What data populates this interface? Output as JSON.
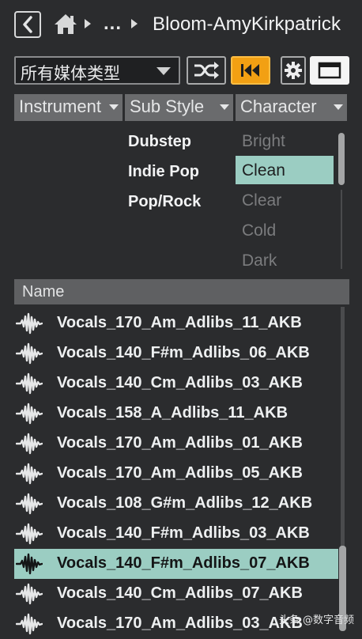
{
  "breadcrumb": {
    "ellipsis": "...",
    "current": "Bloom-AmyKirkpatrick"
  },
  "toolbar": {
    "media_type": "所有媒体类型"
  },
  "filters": {
    "columns": [
      "Instrument",
      "Sub Style",
      "Character"
    ],
    "sub_styles": [
      "Dubstep",
      "Indie Pop",
      "Pop/Rock"
    ],
    "characters": [
      "Bright",
      "Clean",
      "Clear",
      "Cold",
      "Dark"
    ],
    "selected_character": "Clean"
  },
  "results": {
    "header": "Name",
    "items": [
      "Vocals_170_Am_Adlibs_11_AKB",
      "Vocals_140_F#m_Adlibs_06_AKB",
      "Vocals_140_Cm_Adlibs_03_AKB",
      "Vocals_158_A_Adlibs_11_AKB",
      "Vocals_170_Am_Adlibs_01_AKB",
      "Vocals_170_Am_Adlibs_05_AKB",
      "Vocals_108_G#m_Adlibs_12_AKB",
      "Vocals_140_F#m_Adlibs_03_AKB",
      "Vocals_140_F#m_Adlibs_07_AKB",
      "Vocals_140_Cm_Adlibs_07_AKB",
      "Vocals_170_Am_Adlibs_03_AKB"
    ],
    "selected_item": "Vocals_140_F#m_Adlibs_07_AKB"
  },
  "watermark": "头条 @数字音频",
  "colors": {
    "accent_orange": "#f2a013",
    "selection_teal": "#9bcdc2",
    "background": "#2b2c2e"
  }
}
